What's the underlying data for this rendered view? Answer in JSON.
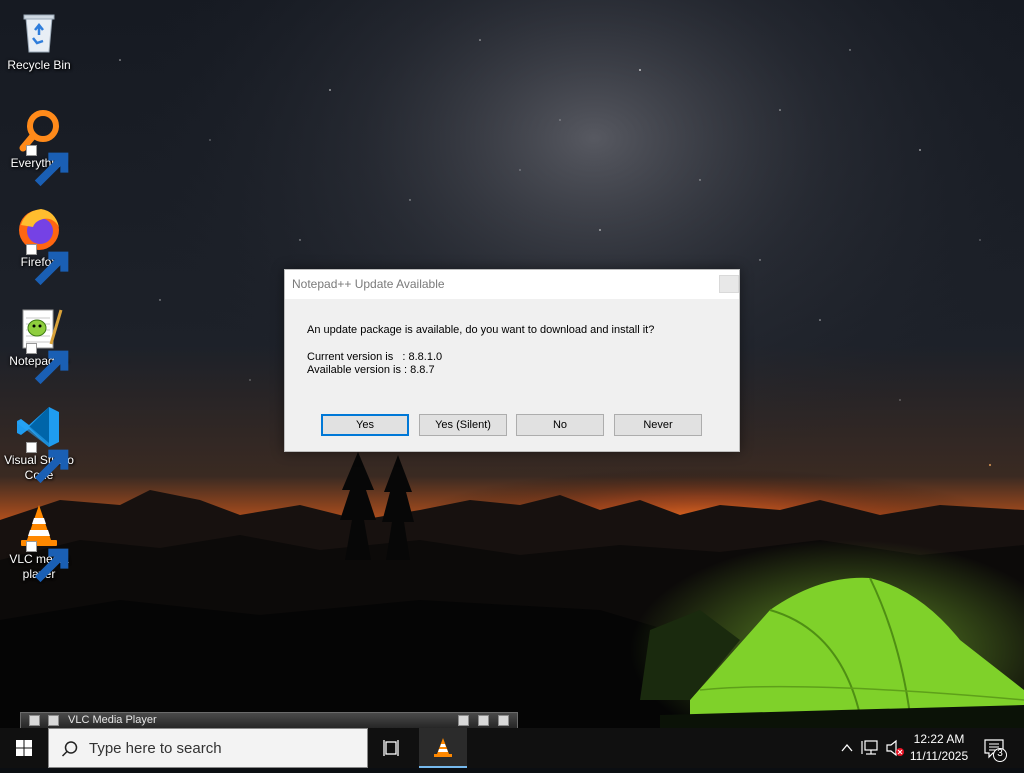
{
  "desktop": {
    "icons": [
      {
        "label": "Recycle Bin"
      },
      {
        "label": "Everything"
      },
      {
        "label": "Firefox"
      },
      {
        "label": "Notepad++"
      },
      {
        "label": "Visual Studio Code"
      },
      {
        "label": "VLC media player"
      }
    ]
  },
  "dialog": {
    "title": "Notepad++ Update Available",
    "message": "An update package is available, do you want to download and install it?",
    "current_version": "Current version is   : 8.8.1.0",
    "available_version": "Available version is : 8.8.7",
    "buttons": {
      "yes": "Yes",
      "yes_silent": "Yes (Silent)",
      "no": "No",
      "never": "Never"
    }
  },
  "vlc_mini": {
    "title": "VLC Media Player"
  },
  "taskbar": {
    "search_placeholder": "Type here to search",
    "clock": {
      "time": "12:22 AM",
      "date": "11/11/2025"
    },
    "notification_count": "3"
  },
  "colors": {
    "accent": "#0078d7",
    "taskbar": "#101010",
    "tent": "#7fd12a",
    "sky_glow": "#ff6a1a"
  }
}
